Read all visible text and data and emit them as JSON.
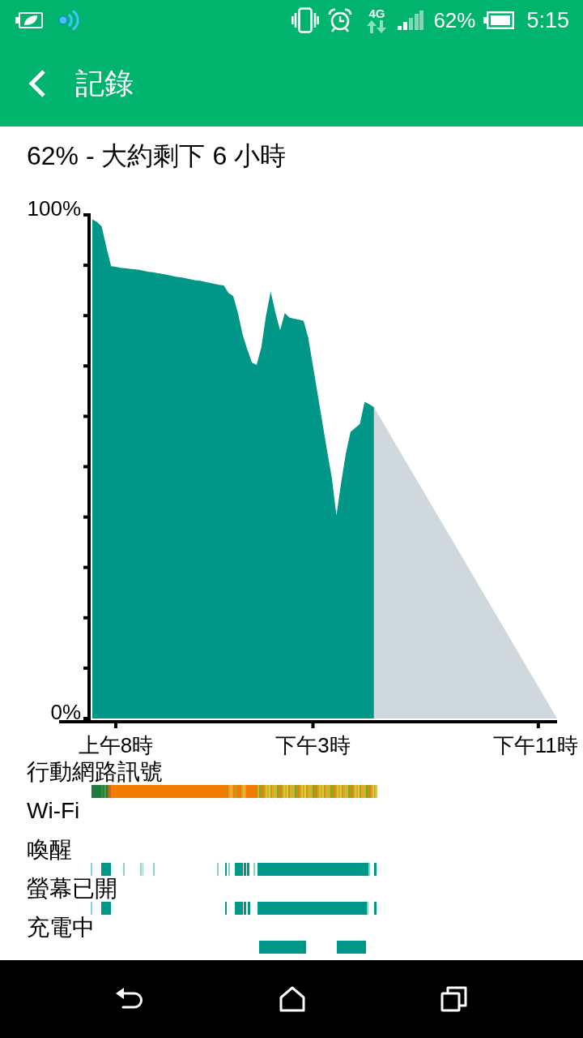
{
  "status_bar": {
    "network_type": "4G",
    "battery": "62%",
    "time": "5:15"
  },
  "app_bar": {
    "title": "記錄"
  },
  "summary": "62% - 大約剩下 6 小時",
  "chart": {
    "chart_data": {
      "type": "area",
      "categories": [
        null,
        null,
        null,
        null,
        null,
        "上午8時",
        null,
        null,
        null,
        null,
        null,
        null,
        null,
        null,
        null,
        null,
        null,
        null,
        null,
        null,
        null,
        null,
        null,
        null,
        null,
        null,
        null,
        null,
        null,
        null,
        null,
        null,
        null,
        null,
        null,
        null,
        null,
        null,
        null,
        null,
        null,
        null,
        null,
        null,
        null,
        null,
        null,
        "下午3時",
        null,
        null,
        null,
        null,
        null,
        null,
        null,
        null,
        null,
        null,
        null,
        null,
        null,
        null,
        null,
        null,
        null,
        null,
        null,
        null,
        null,
        null,
        null,
        null,
        null,
        null,
        null,
        null,
        null,
        null,
        null,
        null,
        null,
        null,
        null,
        null,
        null,
        null,
        null,
        null,
        null,
        null,
        null,
        null,
        null,
        null,
        null,
        "下午11時",
        null,
        null,
        null,
        null
      ],
      "series": [
        {
          "color": "#009688",
          "values": [
            99.1,
            98.6,
            97.7,
            93.6,
            89.8,
            89.7,
            89.5,
            89.4,
            89.3,
            89.2,
            89.1,
            88.9,
            88.7,
            88.6,
            88.4,
            88.3,
            88.1,
            87.9,
            87.7,
            87.6,
            87.4,
            87.2,
            87.0,
            86.9,
            86.7,
            86.5,
            86.3,
            86.1,
            86.0,
            84.5,
            83.9,
            80.6,
            76.3,
            73.3,
            70.7,
            70.2,
            73.7,
            80.0,
            84.8,
            80.6,
            77.1,
            80.5,
            79.6,
            79.4,
            79.2,
            79.0,
            75.6,
            70.0,
            64.4,
            58.8,
            53.2,
            47.9,
            40.3,
            46.8,
            52.6,
            56.9,
            57.7,
            58.5,
            62.9,
            62.4,
            61.8,
            null,
            null,
            null,
            null,
            null,
            null,
            null,
            null,
            null,
            null,
            null,
            null,
            null,
            null,
            null,
            null,
            null,
            null,
            null,
            null,
            null,
            null,
            null,
            null,
            null,
            null,
            null,
            null,
            null,
            null,
            null,
            null,
            null,
            null,
            null,
            null,
            null,
            null,
            null
          ]
        },
        {
          "color": "#cfd8dc",
          "values": [
            null,
            null,
            null,
            null,
            null,
            null,
            null,
            null,
            null,
            null,
            null,
            null,
            null,
            null,
            null,
            null,
            null,
            null,
            null,
            null,
            null,
            null,
            null,
            null,
            null,
            null,
            null,
            null,
            null,
            null,
            null,
            null,
            null,
            null,
            null,
            null,
            null,
            null,
            null,
            null,
            null,
            null,
            null,
            null,
            null,
            null,
            null,
            null,
            null,
            null,
            null,
            null,
            null,
            null,
            null,
            null,
            null,
            null,
            null,
            null,
            61.8,
            null,
            null,
            null,
            null,
            null,
            null,
            null,
            null,
            null,
            null,
            null,
            null,
            null,
            null,
            null,
            null,
            null,
            null,
            null,
            null,
            null,
            null,
            null,
            null,
            null,
            null,
            null,
            null,
            null,
            null,
            null,
            null,
            null,
            null,
            null,
            null,
            null,
            null,
            0
          ]
        }
      ],
      "ylim": [
        0,
        100
      ],
      "yticks": [
        {
          "value": 0,
          "label": "0%"
        },
        {
          "value": 100,
          "label": "100%"
        }
      ]
    }
  },
  "timelines": [
    {
      "label": "行動網路訊號",
      "kind": "signal"
    },
    {
      "label": "Wi-Fi",
      "kind": "wifi"
    },
    {
      "label": "喚醒",
      "kind": "awake"
    },
    {
      "label": "螢幕已開",
      "kind": "screen"
    },
    {
      "label": "充電中",
      "kind": "charging"
    }
  ]
}
